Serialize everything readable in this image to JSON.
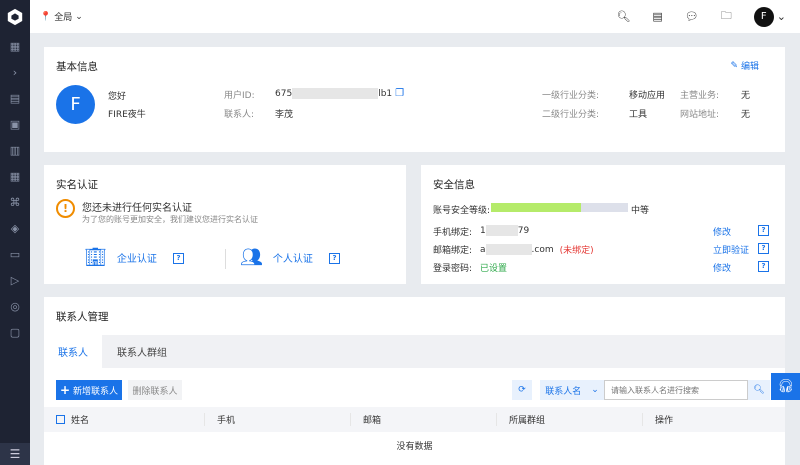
{
  "topbar": {
    "location": "全局",
    "avatar": "F"
  },
  "basic": {
    "title": "基本信息",
    "edit": "编辑",
    "avatar": "F",
    "greeting": "您好",
    "name": "FIRE夜牛",
    "user_id_label": "用户ID:",
    "user_id_start": "675",
    "user_id_end": "lb1",
    "contact_label": "联系人:",
    "contact": "李茂",
    "industry1_label": "一级行业分类:",
    "industry1": "移动应用",
    "industry2_label": "二级行业分类:",
    "industry2": "工具",
    "business_label": "主营业务:",
    "business": "无",
    "website_label": "网站地址:",
    "website": "无"
  },
  "realname": {
    "title": "实名认证",
    "warning": "您还未进行任何实名认证",
    "hint": "为了您的账号更加安全，我们建议您进行实名认证",
    "enterprise": "企业认证",
    "personal": "个人认证",
    "help": "?"
  },
  "security": {
    "title": "安全信息",
    "level_label": "账号安全等级:",
    "level": "中等",
    "level_pct": 66,
    "rows": [
      {
        "label": "手机绑定:",
        "v1": "1",
        "v2": "79",
        "action": "修改"
      },
      {
        "label": "邮箱绑定:",
        "v1": "a",
        "v2": ".com",
        "status": "(未绑定)",
        "action": "立即验证"
      },
      {
        "label": "登录密码:",
        "status": "已设置",
        "action": "修改"
      }
    ],
    "help": "?"
  },
  "contacts": {
    "title": "联系人管理",
    "tabs": [
      "联系人",
      "联系人群组"
    ],
    "add": "新增联系人",
    "delete": "删除联系人",
    "filter": "联系人名",
    "search_placeholder": "请输入联系人名进行搜索",
    "columns": [
      "姓名",
      "手机",
      "邮箱",
      "所属群组",
      "操作"
    ],
    "empty": "没有数据"
  },
  "colors": {
    "accent": "#1a73e8",
    "sidebar": "#1e2333",
    "bar": "#b5eb6a",
    "warn": "#f08c00",
    "danger": "#e53935",
    "ok": "#2ea84a"
  }
}
